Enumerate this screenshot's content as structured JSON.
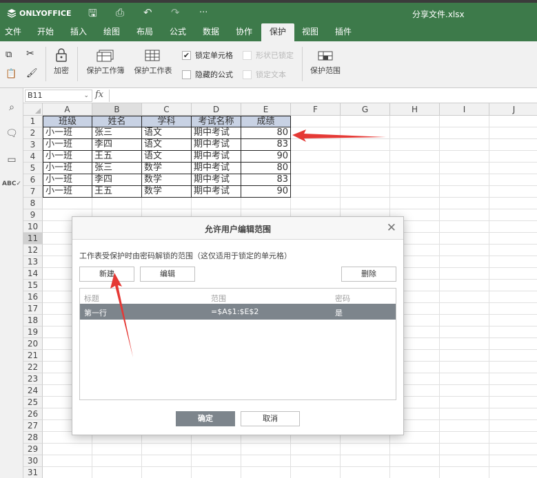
{
  "app": {
    "logo": "ONLYOFFICE",
    "doc_title": "分享文件.xlsx"
  },
  "tabs": [
    "文件",
    "开始",
    "插入",
    "绘图",
    "布局",
    "公式",
    "数据",
    "协作",
    "保护",
    "视图",
    "插件"
  ],
  "active_tab": "保护",
  "toolbar": {
    "encrypt": "加密",
    "protect_workbook": "保护工作簿",
    "protect_sheet": "保护工作表",
    "locked_cell": "锁定单元格",
    "hidden_formula": "隐藏的公式",
    "shape_locked": "形状已锁定",
    "lock_text": "锁定文本",
    "protect_range": "保护范围"
  },
  "formula_bar": {
    "cell_ref": "B11",
    "fx": "fx",
    "content": ""
  },
  "columns": [
    "A",
    "B",
    "C",
    "D",
    "E",
    "F",
    "G",
    "H",
    "I",
    "J"
  ],
  "rows": [
    "1",
    "2",
    "3",
    "4",
    "5",
    "6",
    "7",
    "8",
    "9",
    "10",
    "11",
    "12",
    "13",
    "14",
    "15",
    "16",
    "17",
    "18",
    "19",
    "20",
    "21",
    "22",
    "23",
    "24",
    "25",
    "26",
    "27",
    "28",
    "29",
    "30",
    "31"
  ],
  "sheet": {
    "header": [
      "班级",
      "姓名",
      "学科",
      "考试名称",
      "成绩"
    ],
    "data": [
      [
        "小一班",
        "张三",
        "语文",
        "期中考试",
        "80"
      ],
      [
        "小一班",
        "李四",
        "语文",
        "期中考试",
        "83"
      ],
      [
        "小一班",
        "王五",
        "语文",
        "期中考试",
        "90"
      ],
      [
        "小一班",
        "张三",
        "数学",
        "期中考试",
        "80"
      ],
      [
        "小一班",
        "李四",
        "数学",
        "期中考试",
        "83"
      ],
      [
        "小一班",
        "王五",
        "数学",
        "期中考试",
        "90"
      ]
    ]
  },
  "dialog": {
    "title": "允许用户编辑范围",
    "description": "工作表受保护时由密码解锁的范围（这仅适用于锁定的单元格）",
    "new_button": "新建",
    "edit_button": "编辑",
    "delete_button": "删除",
    "list_headers": {
      "title": "标题",
      "range": "范围",
      "password": "密码"
    },
    "items": [
      {
        "title": "第一行",
        "range": "=$A$1:$E$2",
        "password": "是"
      }
    ],
    "ok_button": "确定",
    "cancel_button": "取消"
  },
  "annotation_color": "#e53935",
  "brand_color": "#3d7a4a"
}
